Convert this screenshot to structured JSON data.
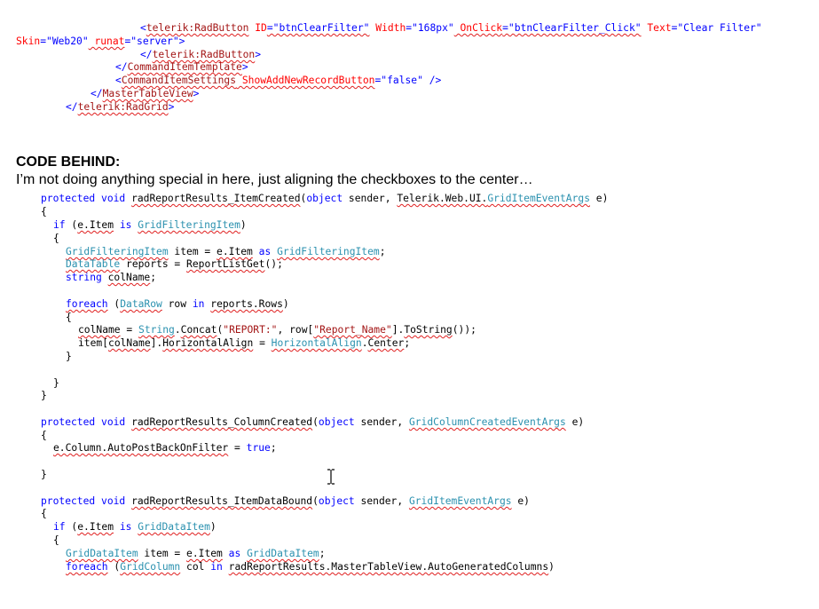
{
  "markup": {
    "l1": {
      "open": "<",
      "tag": "telerik:RadButton",
      "a1": " ID",
      "v1": "=\"btnClearFilter\"",
      "a2": " Width",
      "v2": "=\"168px\"",
      "a3": " OnClick",
      "v3": "=\"btnClearFilter_Click\"",
      "a4": " Text",
      "v4": "=\"Clear Filter\""
    },
    "l2": {
      "a1": "Skin",
      "v1": "=\"Web20\"",
      "a2": " runat",
      "v2": "=\"server\"",
      "close": ">"
    },
    "l3": {
      "open": "</",
      "tag": "telerik:RadButton",
      "close": ">"
    },
    "l4": {
      "open": "</",
      "tag": "CommandItemTemplate",
      "close": ">"
    },
    "l5": {
      "open": "<",
      "tag": "CommandItemSettings",
      "a1": " ShowAddNewRecordButton",
      "v1": "=\"false\"",
      "close": " />"
    },
    "l6": {
      "open": "</",
      "tag": "MasterTableView",
      "close": ">"
    },
    "l7": {
      "open": "</",
      "tag": "telerik:RadGrid",
      "close": ">"
    }
  },
  "heading": "CODE BEHIND:",
  "prose": "I’m not doing anything special in here, just aligning the checkboxes to the center…",
  "code": {
    "c1": {
      "k1": "protected",
      "sp1": " ",
      "k2": "void",
      "sp2": " ",
      "m": "radReportResults_ItemCreated",
      "p1": "(",
      "k3": "object",
      "p2": " sender, ",
      "ns": "Telerik.Web.UI.",
      "t1": "GridItemEventArgs",
      "p3": " e)"
    },
    "c2": {
      "p": "{"
    },
    "c3": {
      "k1": "if",
      "p1": " (",
      "v": "e.Item",
      "sp": " ",
      "k2": "is",
      "sp2": " ",
      "t1": "GridFilteringItem",
      "p2": ")"
    },
    "c4": {
      "p": "{"
    },
    "c5": {
      "t1": "GridFilteringItem",
      "p1": " item = ",
      "v": "e.Item",
      "sp": " ",
      "k1": "as",
      "sp2": " ",
      "t2": "GridFilteringItem",
      "p2": ";"
    },
    "c6": {
      "t1": "DataTable",
      "p1": " reports = ",
      "m": "ReportListGet",
      "p2": "();"
    },
    "c7": {
      "k1": "string",
      "sp": " ",
      "v": "colName",
      "p1": ";"
    },
    "c8": {
      "k1": "foreach",
      "p1": " (",
      "t1": "DataRow",
      "p2": " row ",
      "k2": "in",
      "sp": " ",
      "v": "reports.Rows",
      "p3": ")"
    },
    "c9": {
      "p": "{"
    },
    "c10": {
      "v": "colName",
      "p1": " = ",
      "t1": "String",
      "p2": ".",
      "m": "Concat",
      "p3": "(",
      "s1": "\"REPORT:\"",
      "p4": ", row[",
      "s2": "\"Report_Name\"",
      "p5": "].",
      "m2": "ToString",
      "p6": "());"
    },
    "c11": {
      "p1": "item[",
      "v": "colName",
      "p2": "].",
      "m": "HorizontalAlign",
      "p3": " = ",
      "t1": "HorizontalAlign",
      "p4": ".",
      "m2": "Center",
      "p5": ";"
    },
    "c12": {
      "p": "}"
    },
    "c13": {
      "p": "}"
    },
    "c14": {
      "p": "}"
    },
    "c15": {
      "k1": "protected",
      "sp1": " ",
      "k2": "void",
      "sp2": " ",
      "m": "radReportResults_ColumnCreated",
      "p1": "(",
      "k3": "object",
      "p2": " sender, ",
      "t1": "GridColumnCreatedEventArgs",
      "p3": " e)"
    },
    "c16": {
      "p": "{"
    },
    "c17": {
      "v": "e.Column.AutoPostBackOnFilter",
      "p1": " = ",
      "k1": "true",
      "p2": ";"
    },
    "c18": {
      "p": "}"
    },
    "c19": {
      "k1": "protected",
      "sp1": " ",
      "k2": "void",
      "sp2": " ",
      "m": "radReportResults_ItemDataBound",
      "p1": "(",
      "k3": "object",
      "p2": " sender, ",
      "t1": "GridItemEventArgs",
      "p3": " e)"
    },
    "c20": {
      "p": "{"
    },
    "c21": {
      "k1": "if",
      "p1": " (",
      "v": "e.Item",
      "sp": " ",
      "k2": "is",
      "sp2": " ",
      "t1": "GridDataItem",
      "p2": ")"
    },
    "c22": {
      "p": "{"
    },
    "c23": {
      "t1": "GridDataItem",
      "p1": " item = ",
      "v": "e.Item",
      "sp": " ",
      "k1": "as",
      "sp2": " ",
      "t2": "GridDataItem",
      "p2": ";"
    },
    "c24": {
      "k1": "foreach",
      "p1": " (",
      "t1": "GridColumn",
      "p2": " col ",
      "k2": "in",
      "sp": " ",
      "v": "radReportResults.MasterTableView.AutoGeneratedColumns",
      "p3": ")"
    }
  }
}
